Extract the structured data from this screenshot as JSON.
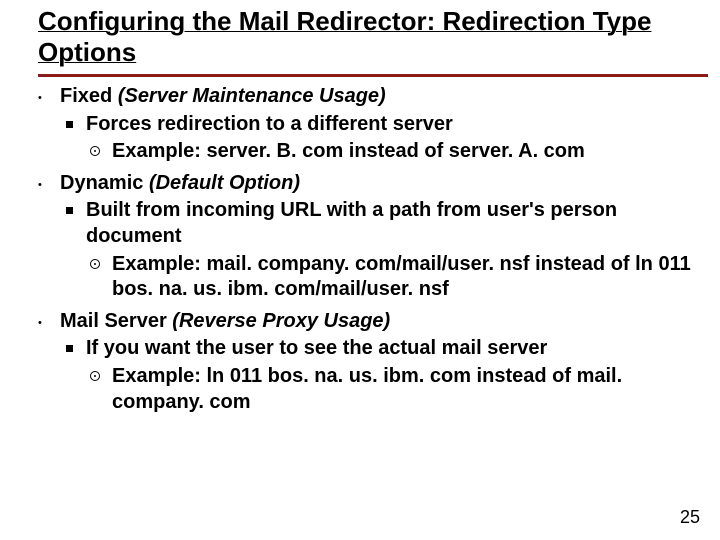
{
  "title": "Configuring the Mail Redirector: Redirection Type Options",
  "accent_color": "#8b1a1a",
  "page_number": "25",
  "items": [
    {
      "heading_bold": "Fixed",
      "heading_italic": "(Server Maintenance Usage)",
      "sub": {
        "text": "Forces redirection to a different server",
        "example": "Example: server. B. com instead of server. A. com"
      }
    },
    {
      "heading_bold": "Dynamic",
      "heading_italic": "(Default Option)",
      "sub": {
        "text": "Built from incoming URL with a path from user's person document",
        "example": "Example: mail. company. com/mail/user. nsf instead of ln 011 bos. na. us. ibm. com/mail/user. nsf"
      }
    },
    {
      "heading_bold": "Mail Server",
      "heading_italic": "(Reverse Proxy Usage)",
      "sub": {
        "text": "If you want the user to see the actual mail server",
        "example": "Example: ln 011 bos. na. us. ibm. com instead of mail. company. com"
      }
    }
  ]
}
